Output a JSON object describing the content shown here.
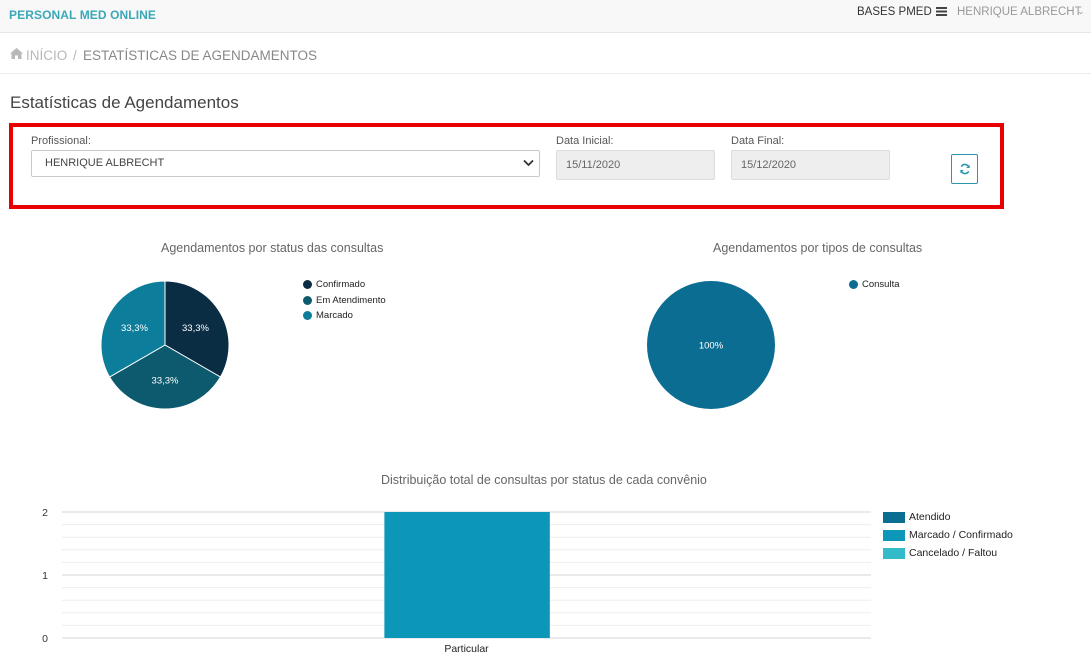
{
  "header": {
    "brand": "PERSONAL MED ONLINE",
    "bases_label": "BASES PMED",
    "bases_icon": "database-icon",
    "user_name": "HENRIQUE ALBRECHT",
    "user_chevron": "⌄"
  },
  "breadcrumb": {
    "home_icon": "home-icon",
    "home_label": "INÍCIO",
    "separator": "/",
    "current": "ESTATÍSTICAS DE AGENDAMENTOS"
  },
  "page": {
    "title": "Estatísticas de Agendamentos"
  },
  "filters": {
    "profissional_label": "Profissional:",
    "profissional_value": "HENRIQUE ALBRECHT",
    "data_inicial_label": "Data Inicial:",
    "data_inicial_value": "15/11/2020",
    "data_final_label": "Data Final:",
    "data_final_value": "15/12/2020",
    "refresh_icon": "refresh-icon"
  },
  "colors": {
    "highlight_border": "#e80000",
    "brand": "#3aa8b8",
    "confirmado": "#0b2d43",
    "em_atendimento": "#0d5a6f",
    "marcado": "#0c7d9a",
    "consulta": "#0c6d93",
    "atendido": "#0c6d93",
    "marcado_confirmado": "#0c96b8",
    "cancelado_faltou": "#33bbc9"
  },
  "chart_data": [
    {
      "type": "pie",
      "title": "Agendamentos por status das consultas",
      "legend_position": "right",
      "slices": [
        {
          "name": "Confirmado",
          "value": 33.3,
          "label": "33,3%"
        },
        {
          "name": "Em Atendimento",
          "value": 33.3,
          "label": "33,3%"
        },
        {
          "name": "Marcado",
          "value": 33.3,
          "label": "33,3%"
        }
      ]
    },
    {
      "type": "pie",
      "title": "Agendamentos por tipos de consultas",
      "legend_position": "right",
      "slices": [
        {
          "name": "Consulta",
          "value": 100,
          "label": "100%"
        }
      ]
    },
    {
      "type": "bar",
      "title": "Distribuição total de consultas por status de cada convênio",
      "categories": [
        "Particular"
      ],
      "series": [
        {
          "name": "Atendido",
          "values": [
            0
          ]
        },
        {
          "name": "Marcado / Confirmado",
          "values": [
            2
          ]
        },
        {
          "name": "Cancelado / Faltou",
          "values": [
            0
          ]
        }
      ],
      "ylim": [
        0,
        2
      ],
      "yticks": [
        "0",
        "1",
        "2"
      ],
      "grid": true,
      "legend_position": "right"
    }
  ]
}
